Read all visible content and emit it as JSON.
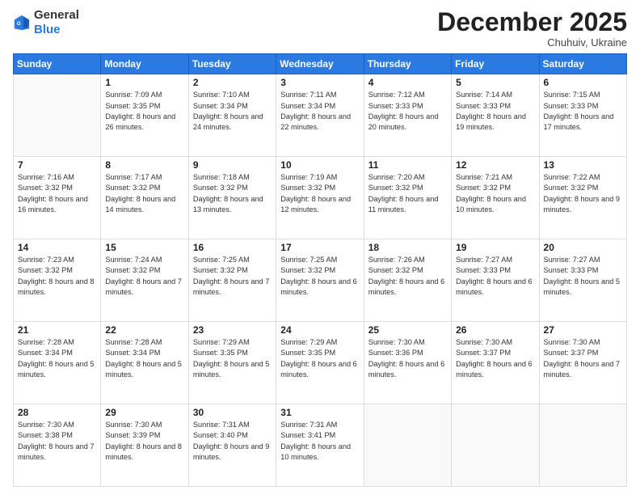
{
  "header": {
    "logo_general": "General",
    "logo_blue": "Blue",
    "month_title": "December 2025",
    "location": "Chuhuiv, Ukraine"
  },
  "days_of_week": [
    "Sunday",
    "Monday",
    "Tuesday",
    "Wednesday",
    "Thursday",
    "Friday",
    "Saturday"
  ],
  "weeks": [
    [
      {
        "day": "",
        "sunrise": "",
        "sunset": "",
        "daylight": ""
      },
      {
        "day": "1",
        "sunrise": "Sunrise: 7:09 AM",
        "sunset": "Sunset: 3:35 PM",
        "daylight": "Daylight: 8 hours and 26 minutes."
      },
      {
        "day": "2",
        "sunrise": "Sunrise: 7:10 AM",
        "sunset": "Sunset: 3:34 PM",
        "daylight": "Daylight: 8 hours and 24 minutes."
      },
      {
        "day": "3",
        "sunrise": "Sunrise: 7:11 AM",
        "sunset": "Sunset: 3:34 PM",
        "daylight": "Daylight: 8 hours and 22 minutes."
      },
      {
        "day": "4",
        "sunrise": "Sunrise: 7:12 AM",
        "sunset": "Sunset: 3:33 PM",
        "daylight": "Daylight: 8 hours and 20 minutes."
      },
      {
        "day": "5",
        "sunrise": "Sunrise: 7:14 AM",
        "sunset": "Sunset: 3:33 PM",
        "daylight": "Daylight: 8 hours and 19 minutes."
      },
      {
        "day": "6",
        "sunrise": "Sunrise: 7:15 AM",
        "sunset": "Sunset: 3:33 PM",
        "daylight": "Daylight: 8 hours and 17 minutes."
      }
    ],
    [
      {
        "day": "7",
        "sunrise": "Sunrise: 7:16 AM",
        "sunset": "Sunset: 3:32 PM",
        "daylight": "Daylight: 8 hours and 16 minutes."
      },
      {
        "day": "8",
        "sunrise": "Sunrise: 7:17 AM",
        "sunset": "Sunset: 3:32 PM",
        "daylight": "Daylight: 8 hours and 14 minutes."
      },
      {
        "day": "9",
        "sunrise": "Sunrise: 7:18 AM",
        "sunset": "Sunset: 3:32 PM",
        "daylight": "Daylight: 8 hours and 13 minutes."
      },
      {
        "day": "10",
        "sunrise": "Sunrise: 7:19 AM",
        "sunset": "Sunset: 3:32 PM",
        "daylight": "Daylight: 8 hours and 12 minutes."
      },
      {
        "day": "11",
        "sunrise": "Sunrise: 7:20 AM",
        "sunset": "Sunset: 3:32 PM",
        "daylight": "Daylight: 8 hours and 11 minutes."
      },
      {
        "day": "12",
        "sunrise": "Sunrise: 7:21 AM",
        "sunset": "Sunset: 3:32 PM",
        "daylight": "Daylight: 8 hours and 10 minutes."
      },
      {
        "day": "13",
        "sunrise": "Sunrise: 7:22 AM",
        "sunset": "Sunset: 3:32 PM",
        "daylight": "Daylight: 8 hours and 9 minutes."
      }
    ],
    [
      {
        "day": "14",
        "sunrise": "Sunrise: 7:23 AM",
        "sunset": "Sunset: 3:32 PM",
        "daylight": "Daylight: 8 hours and 8 minutes."
      },
      {
        "day": "15",
        "sunrise": "Sunrise: 7:24 AM",
        "sunset": "Sunset: 3:32 PM",
        "daylight": "Daylight: 8 hours and 7 minutes."
      },
      {
        "day": "16",
        "sunrise": "Sunrise: 7:25 AM",
        "sunset": "Sunset: 3:32 PM",
        "daylight": "Daylight: 8 hours and 7 minutes."
      },
      {
        "day": "17",
        "sunrise": "Sunrise: 7:25 AM",
        "sunset": "Sunset: 3:32 PM",
        "daylight": "Daylight: 8 hours and 6 minutes."
      },
      {
        "day": "18",
        "sunrise": "Sunrise: 7:26 AM",
        "sunset": "Sunset: 3:32 PM",
        "daylight": "Daylight: 8 hours and 6 minutes."
      },
      {
        "day": "19",
        "sunrise": "Sunrise: 7:27 AM",
        "sunset": "Sunset: 3:33 PM",
        "daylight": "Daylight: 8 hours and 6 minutes."
      },
      {
        "day": "20",
        "sunrise": "Sunrise: 7:27 AM",
        "sunset": "Sunset: 3:33 PM",
        "daylight": "Daylight: 8 hours and 5 minutes."
      }
    ],
    [
      {
        "day": "21",
        "sunrise": "Sunrise: 7:28 AM",
        "sunset": "Sunset: 3:34 PM",
        "daylight": "Daylight: 8 hours and 5 minutes."
      },
      {
        "day": "22",
        "sunrise": "Sunrise: 7:28 AM",
        "sunset": "Sunset: 3:34 PM",
        "daylight": "Daylight: 8 hours and 5 minutes."
      },
      {
        "day": "23",
        "sunrise": "Sunrise: 7:29 AM",
        "sunset": "Sunset: 3:35 PM",
        "daylight": "Daylight: 8 hours and 5 minutes."
      },
      {
        "day": "24",
        "sunrise": "Sunrise: 7:29 AM",
        "sunset": "Sunset: 3:35 PM",
        "daylight": "Daylight: 8 hours and 6 minutes."
      },
      {
        "day": "25",
        "sunrise": "Sunrise: 7:30 AM",
        "sunset": "Sunset: 3:36 PM",
        "daylight": "Daylight: 8 hours and 6 minutes."
      },
      {
        "day": "26",
        "sunrise": "Sunrise: 7:30 AM",
        "sunset": "Sunset: 3:37 PM",
        "daylight": "Daylight: 8 hours and 6 minutes."
      },
      {
        "day": "27",
        "sunrise": "Sunrise: 7:30 AM",
        "sunset": "Sunset: 3:37 PM",
        "daylight": "Daylight: 8 hours and 7 minutes."
      }
    ],
    [
      {
        "day": "28",
        "sunrise": "Sunrise: 7:30 AM",
        "sunset": "Sunset: 3:38 PM",
        "daylight": "Daylight: 8 hours and 7 minutes."
      },
      {
        "day": "29",
        "sunrise": "Sunrise: 7:30 AM",
        "sunset": "Sunset: 3:39 PM",
        "daylight": "Daylight: 8 hours and 8 minutes."
      },
      {
        "day": "30",
        "sunrise": "Sunrise: 7:31 AM",
        "sunset": "Sunset: 3:40 PM",
        "daylight": "Daylight: 8 hours and 9 minutes."
      },
      {
        "day": "31",
        "sunrise": "Sunrise: 7:31 AM",
        "sunset": "Sunset: 3:41 PM",
        "daylight": "Daylight: 8 hours and 10 minutes."
      },
      {
        "day": "",
        "sunrise": "",
        "sunset": "",
        "daylight": ""
      },
      {
        "day": "",
        "sunrise": "",
        "sunset": "",
        "daylight": ""
      },
      {
        "day": "",
        "sunrise": "",
        "sunset": "",
        "daylight": ""
      }
    ]
  ]
}
